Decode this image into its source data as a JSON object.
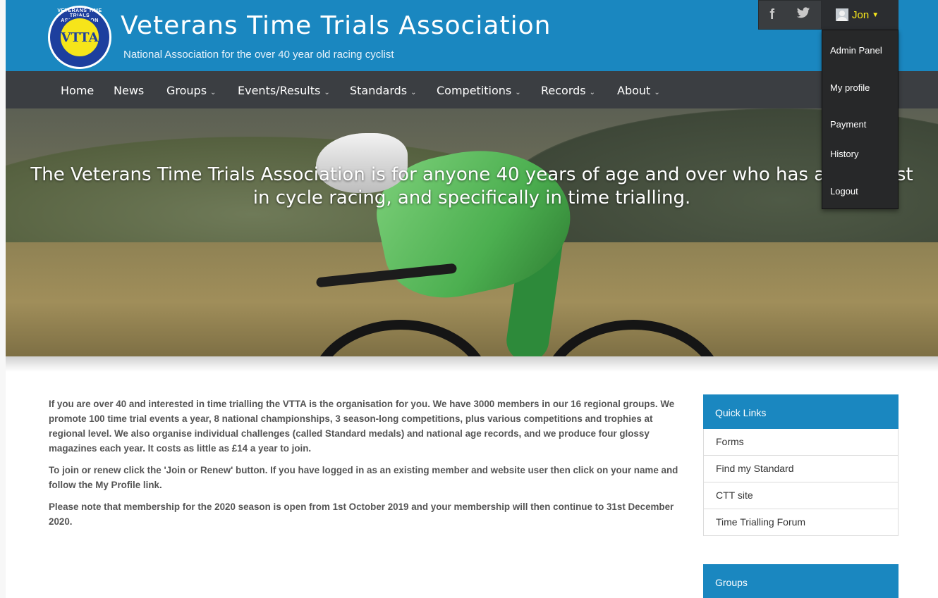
{
  "header": {
    "title": "Veterans Time Trials Association",
    "subtitle": "National Association for the over 40 year old racing cyclist",
    "logo_letters": "VTTA",
    "logo_ring_text": "VETERANS TIME TRIALS ASSOCIATION",
    "social": [
      "f",
      "t"
    ],
    "user": "Jon"
  },
  "dropdown": {
    "items": [
      "Admin Panel",
      "My profile",
      "Payment",
      "History",
      "Logout"
    ]
  },
  "nav": {
    "items": [
      "Home",
      "News",
      "Groups",
      "Events/Results",
      "Standards",
      "Competitions",
      "Records",
      "About"
    ]
  },
  "hero": {
    "line1": "The Veterans Time Trials Association is for anyone 40 years of age and over who has an interest",
    "line2": "in cycle racing, and specifically in time trialling."
  },
  "content": {
    "p1": "If you are over 40 and interested in time trialling the VTTA is the organisation for you. We have 3000 members in our 16 regional groups. We promote 100 time trial events a year, 8 national championships, 3 season-long  competitions, plus various competitions and trophies at regional level. We also organise individual challenges (called Standard medals) and national age records, and we produce four glossy magazines each year. It costs as little as £14 a year to join.",
    "p2": "To join or renew click the 'Join or Renew' button. If you have logged in as an existing member and website user then click on your name and follow the My Profile link.",
    "p3": "Please note that membership for the 2020 season is open from 1st October 2019 and your membership will then continue to 31st December 2020."
  },
  "sidebar": {
    "quick_links_title": "Quick Links",
    "links": [
      "Forms",
      "Find my Standard",
      "CTT site",
      "Time Trialling Forum"
    ],
    "groups_title": "Groups"
  }
}
